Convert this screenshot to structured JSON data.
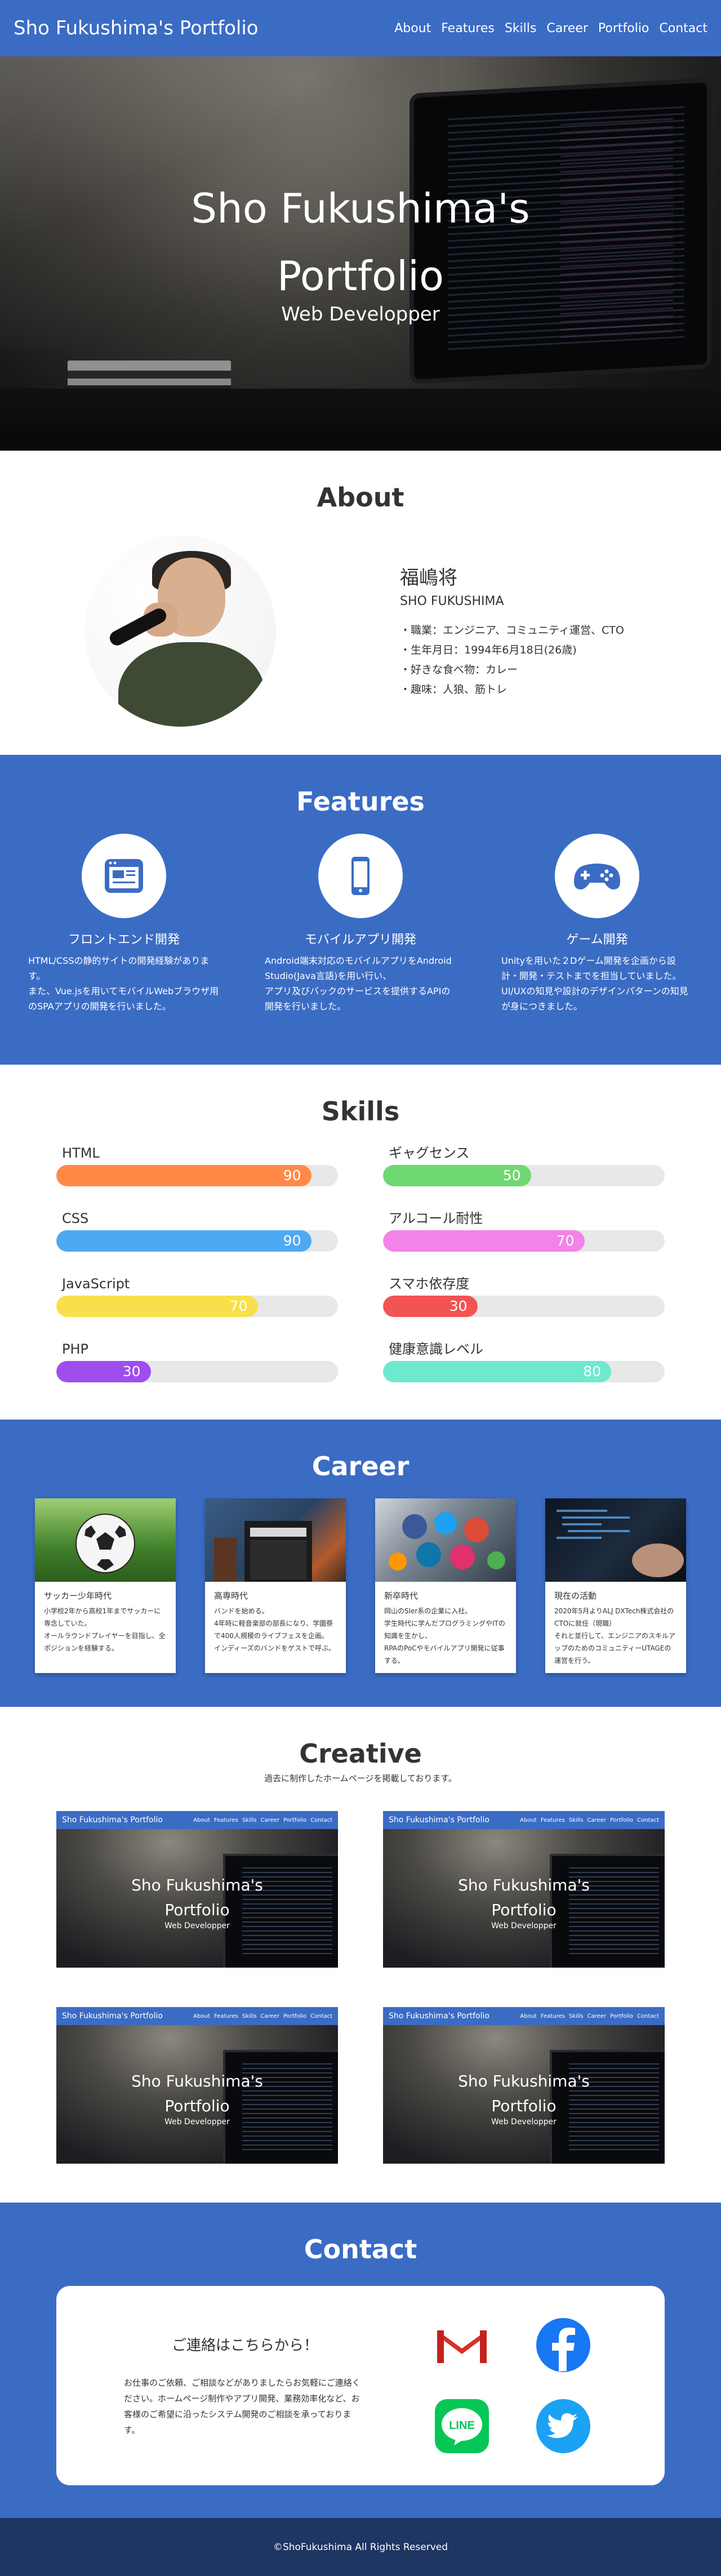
{
  "header": {
    "logo": "Sho Fukushima's Portfolio",
    "nav": [
      "About",
      "Features",
      "Skills",
      "Career",
      "Portfolio",
      "Contact"
    ]
  },
  "hero": {
    "title": "Sho Fukushima's Portfolio",
    "subtitle": "Web Developper"
  },
  "about": {
    "title": "About",
    "name": "福嶋将",
    "roman": "SHO FUKUSHIMA",
    "items": [
      "・職業：エンジニア、コミュニティ運営、CTO",
      "・生年月日：1994年6月18日(26歳)",
      "・好きな食べ物：カレー",
      "・趣味：人狼、筋トレ"
    ]
  },
  "features": {
    "title": "Features",
    "items": [
      {
        "title": "フロントエンド開発",
        "icon": "browser-window-icon",
        "desc": "HTML/CSSの静的サイトの開発経験があります。\nまた、Vue.jsを用いてモバイルWebブラウザ用のSPAアプリの開発を行いました。"
      },
      {
        "title": "モバイルアプリ開発",
        "icon": "smartphone-icon",
        "desc": "Android端末対応のモバイルアプリをAndroid Studio(Java言語)を用い行い、\nアプリ及びバックのサービスを提供するAPIの開発を行いました。"
      },
      {
        "title": "ゲーム開発",
        "icon": "gamepad-icon",
        "desc": "Unityを用いた２Dゲーム開発を企画から設計・開発・テストまでを担当していました。\nUI/UXの知見や設計のデザインパターンの知見が身につきました。"
      }
    ]
  },
  "skills": {
    "title": "Skills",
    "items": [
      {
        "name": "HTML",
        "value": 90,
        "color": "#FF8A47"
      },
      {
        "name": "ギャグセンス",
        "value": 50,
        "color": "#6FD873"
      },
      {
        "name": "CSS",
        "value": 90,
        "color": "#4DA9F2"
      },
      {
        "name": "アルコール耐性",
        "value": 70,
        "color": "#F283E8"
      },
      {
        "name": "JavaScript",
        "value": 70,
        "color": "#F7E04B"
      },
      {
        "name": "スマホ依存度",
        "value": 30,
        "color": "#F25353"
      },
      {
        "name": "PHP",
        "value": 30,
        "color": "#A04DF0"
      },
      {
        "name": "健康意識レベル",
        "value": 80,
        "color": "#6FE8D0"
      }
    ]
  },
  "career": {
    "title": "Career",
    "items": [
      {
        "title": "サッカー少年時代",
        "image": "soccer-ball",
        "desc": "小学校2年から高校1年までサッカーに専念していた。\nオールラウンドプレイヤーを目指し、全ポジションを経験する。"
      },
      {
        "title": "高専時代",
        "image": "guitar-amp",
        "desc": "バンドを始める。\n4年時に軽音楽部の部長になり、学園祭で400人規模のライブフェスを企画。\nインディーズのバンドをゲストで呼ぶ。"
      },
      {
        "title": "新卒時代",
        "image": "social-media",
        "desc": "岡山のSler系の企業に入社。\n学生時代に学んだプログラミングやITの知識を生かし、\nRPAのPoCやモバイルアプリ開発に従事する。"
      },
      {
        "title": "現在の活動",
        "image": "laptop-code",
        "desc": "2020年5月よりALJ DXTech株式会社のCTOに就任（現職）\nそれと並行して、エンジニアのスキルアップのためのコミュニティーUTAGEの運営を行う。"
      }
    ]
  },
  "creative": {
    "title": "Creative",
    "subtitle": "過去に制作したホームページを掲載しております。",
    "shot": {
      "logo": "Sho Fukushima's Portfolio",
      "nav": [
        "About",
        "Features",
        "Skills",
        "Career",
        "Portfolio",
        "Contact"
      ],
      "title": "Sho Fukushima's Portfolio",
      "subtitle": "Web Developper"
    }
  },
  "contact": {
    "title": "Contact",
    "heading": "ご連絡はこちらから！",
    "desc": "お仕事のご依頼、ご相談などがありましたらお気軽にご連絡ください。ホームページ制作やアプリ開発、業務効率化など、お客様のご希望に沿ったシステム開発のご相談を承っております。",
    "icons": [
      "gmail-icon",
      "facebook-icon",
      "line-icon",
      "twitter-icon"
    ]
  },
  "footer": {
    "copyright": "©ShoFukushima All Rights Reserved"
  },
  "colors": {
    "primary": "#3B6CC4",
    "footer": "#1F3562"
  }
}
